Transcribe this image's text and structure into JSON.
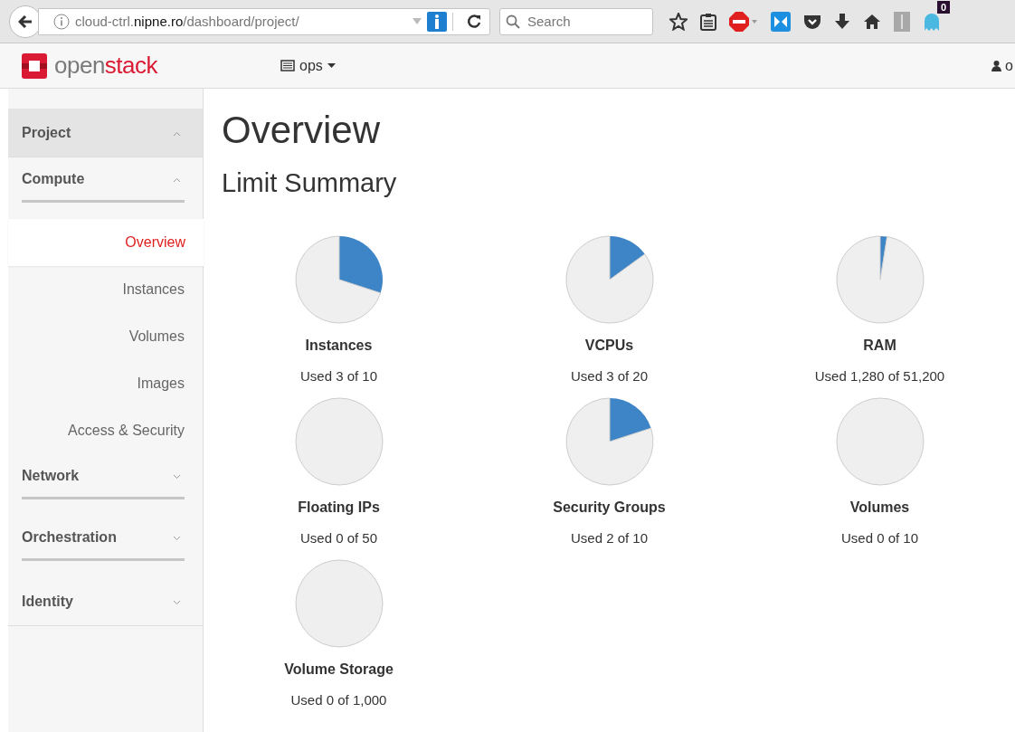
{
  "browser": {
    "url": "cloud-ctrl.**nipne.ro**/dashboard/project/",
    "search": {
      "placeholder": "Search"
    },
    "badge": "0"
  },
  "header": {
    "logo": {
      "prefix": "open",
      "suffix": "stack"
    },
    "project": "ops",
    "user": "o"
  },
  "sidebar": {
    "panels": [
      {
        "label": "Project",
        "expanded": true,
        "children": [
          {
            "label": "Compute",
            "expanded": true,
            "items": [
              {
                "label": "Overview",
                "selected": true
              },
              {
                "label": "Instances",
                "selected": false
              },
              {
                "label": "Volumes",
                "selected": false
              },
              {
                "label": "Images",
                "selected": false
              },
              {
                "label": "Access & Security",
                "selected": false
              }
            ]
          },
          {
            "label": "Network",
            "expanded": false
          },
          {
            "label": "Orchestration",
            "expanded": false
          }
        ]
      },
      {
        "label": "Identity",
        "expanded": false
      }
    ]
  },
  "main": {
    "title": "Overview",
    "subtitle": "Limit Summary",
    "quotas": [
      {
        "name": "Instances",
        "usage": "Used 3 of 10",
        "chart_data": {
          "type": "pie",
          "values": [
            30,
            70
          ]
        }
      },
      {
        "name": "VCPUs",
        "usage": "Used 3 of 20",
        "chart_data": {
          "type": "pie",
          "values": [
            15,
            85
          ]
        }
      },
      {
        "name": "RAM",
        "usage": "Used 1,280 of 51,200",
        "chart_data": {
          "type": "pie",
          "values": [
            2.5,
            97.5
          ]
        }
      },
      {
        "name": "Floating IPs",
        "usage": "Used 0 of 50",
        "chart_data": {
          "type": "pie",
          "values": [
            0,
            100
          ]
        }
      },
      {
        "name": "Security Groups",
        "usage": "Used 2 of 10",
        "chart_data": {
          "type": "pie",
          "values": [
            20,
            80
          ]
        }
      },
      {
        "name": "Volumes",
        "usage": "Used 0 of 10",
        "chart_data": {
          "type": "pie",
          "values": [
            0,
            100
          ]
        }
      },
      {
        "name": "Volume Storage",
        "usage": "Used 0 of 1,000",
        "chart_data": {
          "type": "pie",
          "values": [
            0,
            100
          ]
        }
      }
    ]
  }
}
